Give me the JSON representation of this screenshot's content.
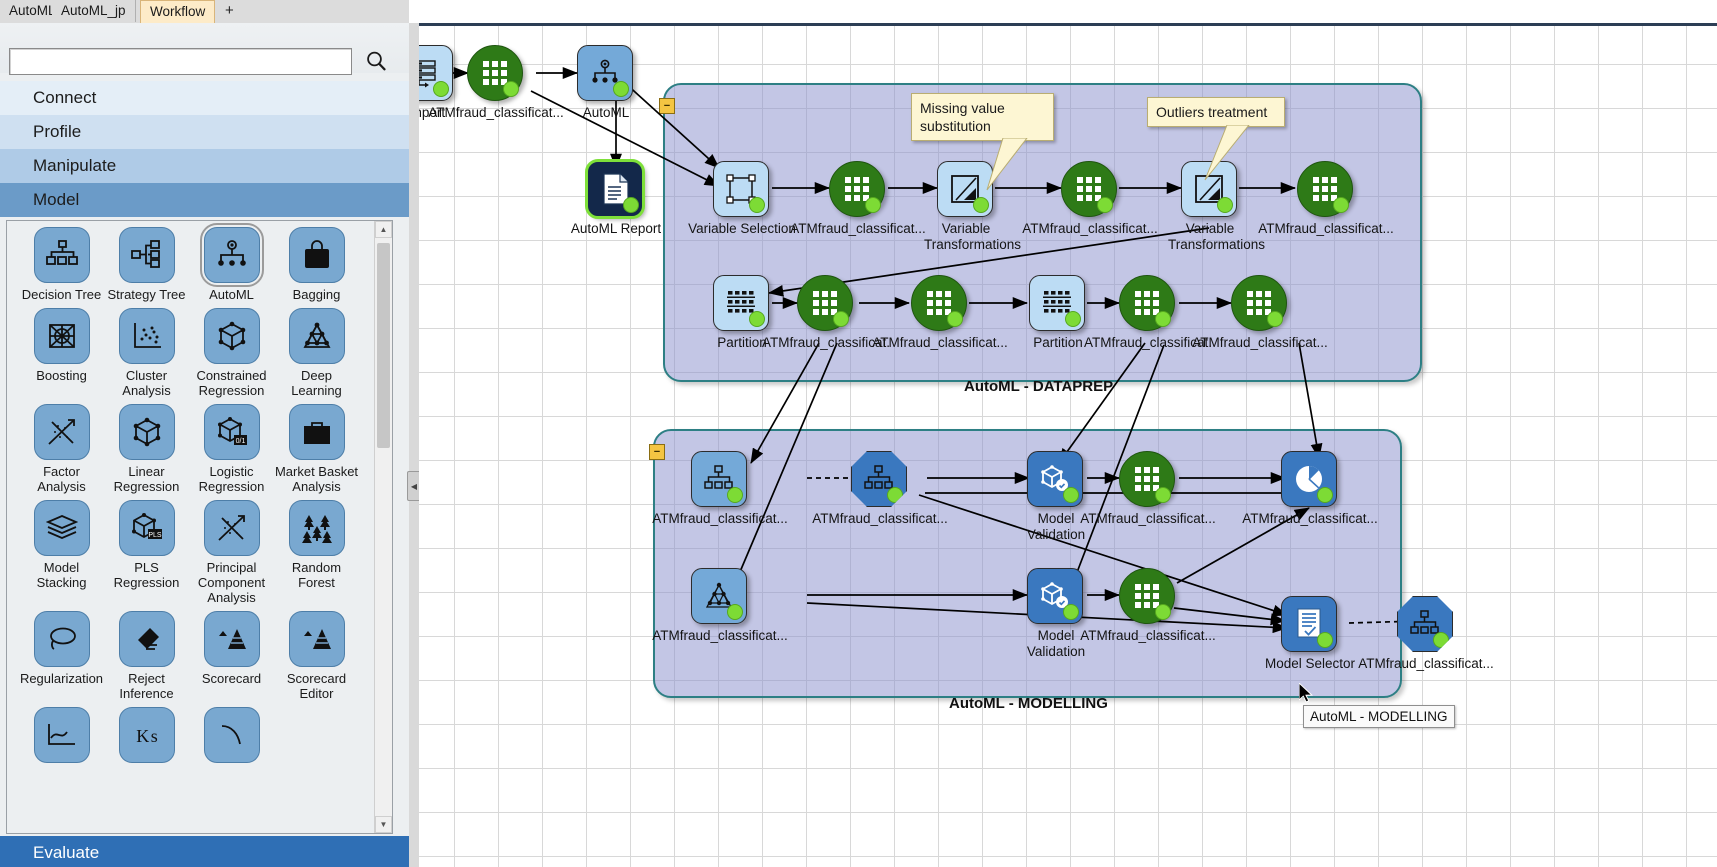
{
  "tabs": [
    {
      "label": "AutoML",
      "active": false
    },
    {
      "label": "AutoML_jp",
      "active": false
    },
    {
      "label": "Workflow",
      "active": true
    }
  ],
  "tab_add_label": "+",
  "search": {
    "value": "",
    "placeholder": "",
    "icon": "search-icon"
  },
  "categories": [
    {
      "label": "Connect"
    },
    {
      "label": "Profile"
    },
    {
      "label": "Manipulate"
    },
    {
      "label": "Model"
    }
  ],
  "footer_category": {
    "label": "Evaluate"
  },
  "palette": {
    "selected": "AutoML",
    "items": [
      {
        "label": "Decision Tree",
        "icon": "decision-tree-icon"
      },
      {
        "label": "Strategy Tree",
        "icon": "strategy-tree-icon"
      },
      {
        "label": "AutoML",
        "icon": "automl-icon"
      },
      {
        "label": "Bagging",
        "icon": "bag-icon"
      },
      {
        "label": "Boosting",
        "icon": "boosting-icon"
      },
      {
        "label": "Cluster Analysis",
        "icon": "scatter-icon"
      },
      {
        "label": "Constrained Regression",
        "icon": "cube-icon"
      },
      {
        "label": "Deep Learning",
        "icon": "neural-net-icon"
      },
      {
        "label": "Factor Analysis",
        "icon": "arrows-icon"
      },
      {
        "label": "Linear Regression",
        "icon": "cube-icon"
      },
      {
        "label": "Logistic Regression",
        "icon": "cube-01-icon"
      },
      {
        "label": "Market Basket Analysis",
        "icon": "briefcase-icon"
      },
      {
        "label": "Model Stacking",
        "icon": "layers-icon"
      },
      {
        "label": "PLS Regression",
        "icon": "cube-pls-icon"
      },
      {
        "label": "Principal Component Analysis",
        "icon": "arrows-icon"
      },
      {
        "label": "Random Forest",
        "icon": "forest-icon"
      },
      {
        "label": "Regularization",
        "icon": "lasso-icon"
      },
      {
        "label": "Reject Inference",
        "icon": "eraser-icon"
      },
      {
        "label": "Scorecard",
        "icon": "scorecard-icon"
      },
      {
        "label": "Scorecard Editor",
        "icon": "scorecard-editor-icon"
      },
      {
        "label": "",
        "icon": "chart-line-icon"
      },
      {
        "label": "",
        "icon": "ks-icon"
      },
      {
        "label": "",
        "icon": "curve-icon"
      }
    ]
  },
  "canvas": {
    "groups": [
      {
        "id": "dataprep",
        "caption": "AutoML - DATAPREP",
        "collapse_glyph": "−"
      },
      {
        "id": "modelling",
        "caption": "AutoML - MODELLING",
        "collapse_glyph": "−"
      }
    ],
    "callouts": [
      {
        "text": "Missing value substitution"
      },
      {
        "text": "Outliers treatment"
      }
    ],
    "nodes": [
      {
        "id": "import",
        "label": "Import",
        "shape": "rounded",
        "fill": "lightblue",
        "icon": "data-import-icon"
      },
      {
        "id": "atm1",
        "label": "ATMfraud_classificat...",
        "shape": "circle",
        "fill": "green",
        "icon": "table-grid-icon"
      },
      {
        "id": "automl",
        "label": "AutoML",
        "shape": "rounded",
        "fill": "midblue",
        "icon": "automl-icon"
      },
      {
        "id": "report",
        "label": "AutoML Report",
        "shape": "rounded",
        "fill": "navy",
        "icon": "document-icon",
        "selected": true
      },
      {
        "id": "varsel",
        "label": "Variable Selection",
        "shape": "rounded",
        "fill": "lightblue",
        "icon": "selection-box-icon"
      },
      {
        "id": "atm2",
        "label": "ATMfraud_classificat...",
        "shape": "circle",
        "fill": "green",
        "icon": "table-grid-icon"
      },
      {
        "id": "vtrans1",
        "label": "Variable Transformations",
        "shape": "rounded",
        "fill": "lightblue",
        "icon": "transform-icon"
      },
      {
        "id": "atm3",
        "label": "ATMfraud_classificat...",
        "shape": "circle",
        "fill": "green",
        "icon": "table-grid-icon"
      },
      {
        "id": "vtrans2",
        "label": "Variable Transformations",
        "shape": "rounded",
        "fill": "lightblue",
        "icon": "transform-icon"
      },
      {
        "id": "atm4",
        "label": "ATMfraud_classificat...",
        "shape": "circle",
        "fill": "green",
        "icon": "table-grid-icon"
      },
      {
        "id": "part1",
        "label": "Partition",
        "shape": "rounded",
        "fill": "lightblue",
        "icon": "partition-icon"
      },
      {
        "id": "atm5",
        "label": "ATMfraud_classificat.",
        "shape": "circle",
        "fill": "green",
        "icon": "table-grid-icon"
      },
      {
        "id": "atm6",
        "label": "ATMfraud_classificat...",
        "shape": "circle",
        "fill": "green",
        "icon": "table-grid-icon"
      },
      {
        "id": "part2",
        "label": "Partition",
        "shape": "rounded",
        "fill": "lightblue",
        "icon": "partition-icon"
      },
      {
        "id": "atm7",
        "label": "ATMfraud_classificat.",
        "shape": "circle",
        "fill": "green",
        "icon": "table-grid-icon"
      },
      {
        "id": "atm8",
        "label": "ATMfraud_classificat...",
        "shape": "circle",
        "fill": "green",
        "icon": "table-grid-icon"
      },
      {
        "id": "dtree1",
        "label": "ATMfraud_classificat...",
        "shape": "rounded",
        "fill": "midblue",
        "icon": "decision-tree-icon"
      },
      {
        "id": "dtreeOct",
        "label": "ATMfraud_classificat...",
        "shape": "octo",
        "fill": "deepblue",
        "icon": "decision-tree-icon"
      },
      {
        "id": "mval1",
        "label": "Model Validation",
        "shape": "rounded",
        "fill": "deepblue",
        "icon": "model-validation-icon"
      },
      {
        "id": "atm9",
        "label": "ATMfraud_classificat...",
        "shape": "circle",
        "fill": "green",
        "icon": "table-grid-icon"
      },
      {
        "id": "pie",
        "label": "ATMfraud_classificat...",
        "shape": "rounded",
        "fill": "deepblue",
        "icon": "pie-chart-icon"
      },
      {
        "id": "nnet",
        "label": "ATMfraud_classificat...",
        "shape": "rounded",
        "fill": "midblue",
        "icon": "neural-net-icon"
      },
      {
        "id": "mval2",
        "label": "Model Validation",
        "shape": "rounded",
        "fill": "deepblue",
        "icon": "model-validation-icon"
      },
      {
        "id": "atm10",
        "label": "ATMfraud_classificat...",
        "shape": "circle",
        "fill": "green",
        "icon": "table-grid-icon"
      },
      {
        "id": "mselector",
        "label": "Model Selector",
        "shape": "rounded",
        "fill": "deepblue",
        "icon": "model-selector-icon"
      },
      {
        "id": "dtreeOct2",
        "label": "ATMfraud_classificat...",
        "shape": "octo",
        "fill": "deepblue",
        "icon": "decision-tree-icon"
      }
    ]
  },
  "tooltip": {
    "text": "AutoML - MODELLING"
  },
  "colors": {
    "accent_blue": "#3a78bf",
    "node_green": "#2e7a17",
    "group_border": "#2d7f84",
    "status_dot": "#7ddb35",
    "selection_green": "#7ee03a",
    "callout_bg": "#fdf6d3"
  }
}
